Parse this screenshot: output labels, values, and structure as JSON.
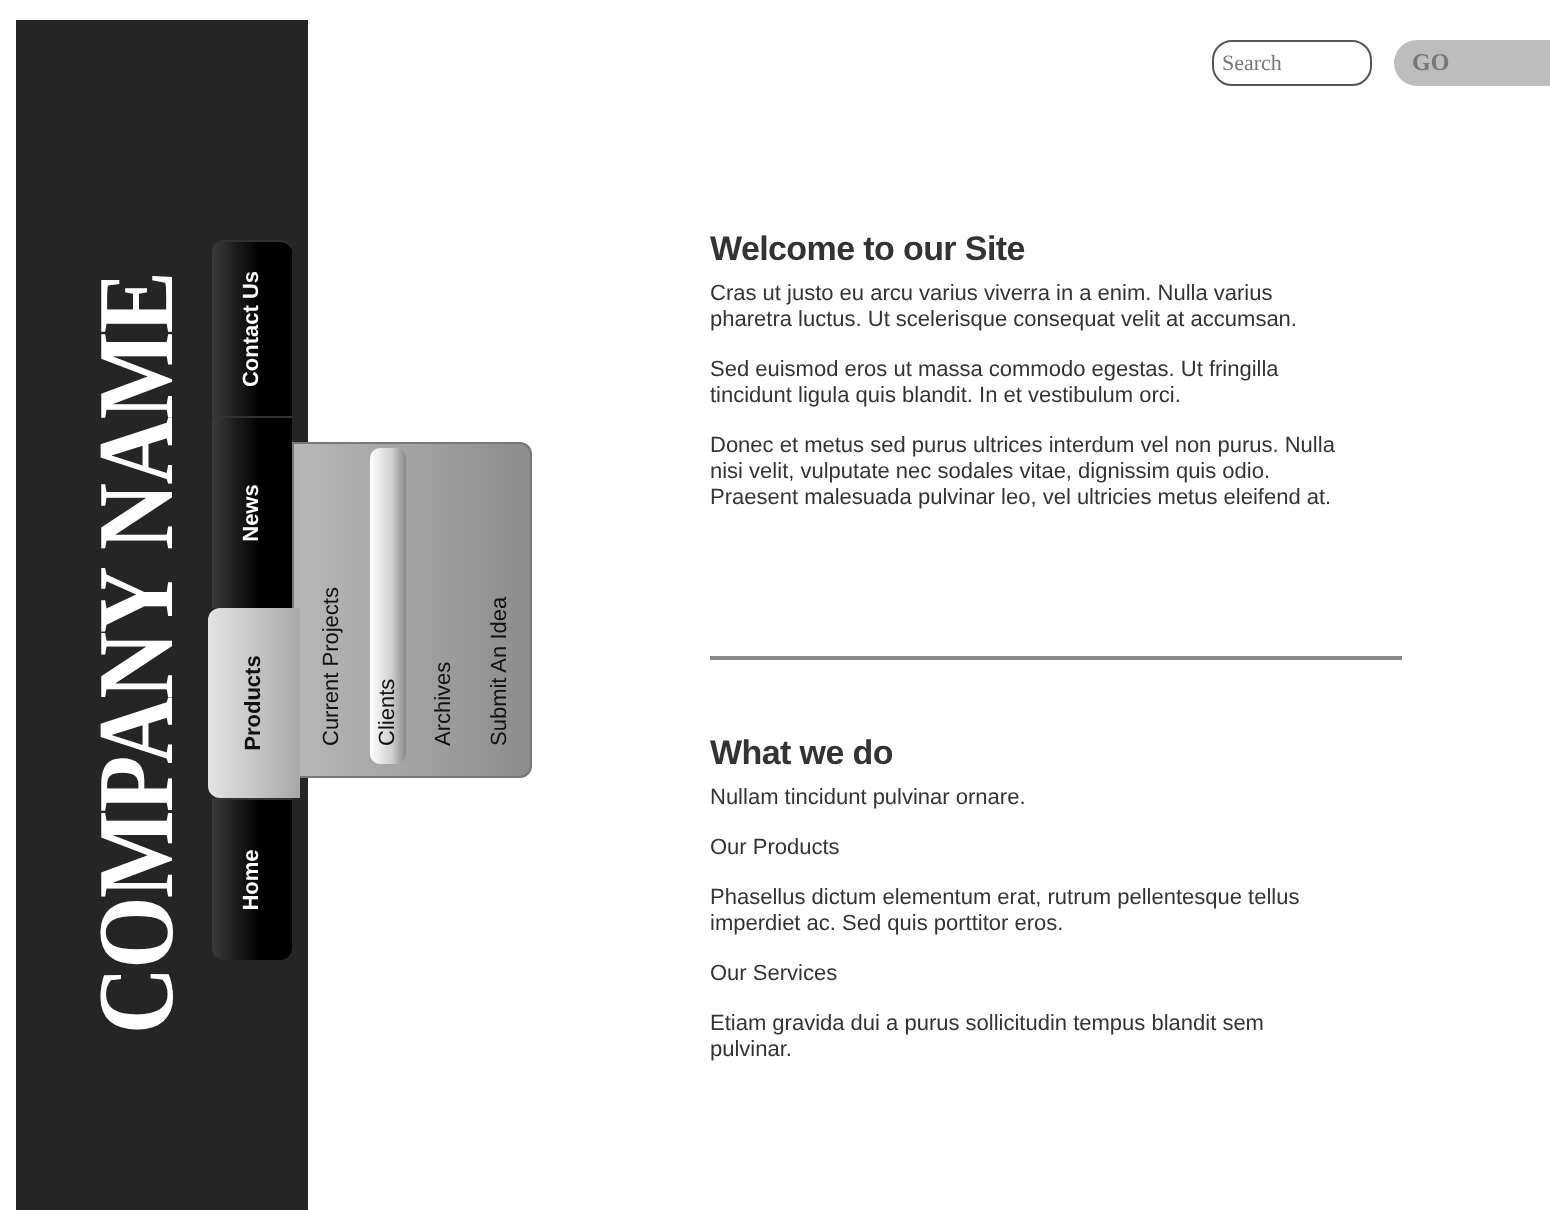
{
  "brand": {
    "name": "COMPANY NAME"
  },
  "search": {
    "placeholder": "Search",
    "button": "GO"
  },
  "nav": {
    "items": [
      {
        "label": "Home",
        "selected": false
      },
      {
        "label": "Products",
        "selected": true,
        "submenu": [
          {
            "label": "Current Projects",
            "selected": false
          },
          {
            "label": "Clients",
            "selected": true
          },
          {
            "label": "Archives",
            "selected": false
          },
          {
            "label": "Submit An Idea",
            "selected": false
          }
        ]
      },
      {
        "label": "News",
        "selected": false
      },
      {
        "label": "Contact Us",
        "selected": false
      }
    ]
  },
  "sections": [
    {
      "title": "Welcome to our Site",
      "paragraphs": [
        "Cras ut justo eu arcu varius viverra in a enim. Nulla varius pharetra luctus. Ut scelerisque consequat velit at accumsan.",
        "Sed euismod eros ut massa commodo egestas. Ut fringilla tincidunt ligula quis blandit. In et vestibulum orci.",
        "Donec et metus sed purus ultrices interdum vel non purus. Nulla nisi velit, vulputate nec sodales vitae, dignissim quis odio. Praesent malesuada pulvinar leo, vel ultricies metus eleifend at."
      ]
    },
    {
      "title": "What we do",
      "paragraphs": [
        "Nullam tincidunt pulvinar ornare.",
        "Our Products",
        "Phasellus dictum elementum erat, rutrum pellentesque tellus imperdiet ac. Sed quis porttitor eros.",
        "Our Services",
        "Etiam gravida dui a purus sollicitudin tempus blandit sem pulvinar."
      ]
    }
  ]
}
